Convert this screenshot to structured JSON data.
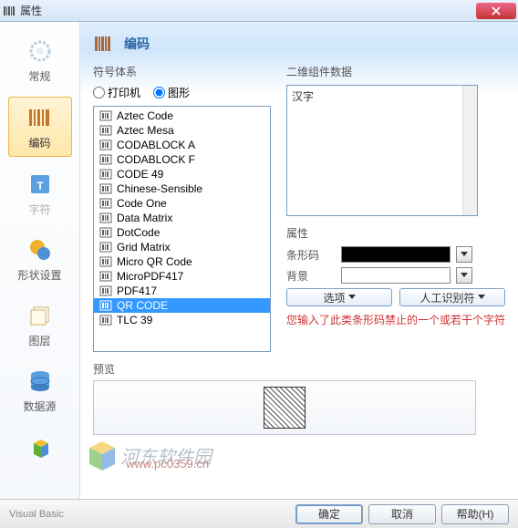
{
  "window": {
    "title": "属性"
  },
  "sidebar": {
    "items": [
      {
        "label": "常规",
        "icon": "gear-icon"
      },
      {
        "label": "编码",
        "icon": "barcode-icon"
      },
      {
        "label": "字符",
        "icon": "text-icon"
      },
      {
        "label": "形状设置",
        "icon": "shape-icon"
      },
      {
        "label": "图层",
        "icon": "layers-icon"
      },
      {
        "label": "数据源",
        "icon": "database-icon"
      }
    ],
    "active_index": 1
  },
  "header": {
    "title": "编码"
  },
  "symbol_group": {
    "title": "符号体系",
    "radio_printer": "打印机",
    "radio_graphic": "图形",
    "selected": "graphic",
    "list": [
      "Aztec Code",
      "Aztec Mesa",
      "CODABLOCK A",
      "CODABLOCK F",
      "CODE 49",
      "Chinese-Sensible",
      "Code One",
      "Data Matrix",
      "DotCode",
      "Grid Matrix",
      "Micro QR Code",
      "MicroPDF417",
      "PDF417",
      "QR CODE",
      "TLC 39"
    ],
    "selected_index": 13
  },
  "data_group": {
    "title": "二维组件数据",
    "value": "汉字"
  },
  "props": {
    "title": "属性",
    "barcode_label": "条形码",
    "barcode_color": "#000000",
    "background_label": "背景",
    "background_color": "#ffffff",
    "options_btn": "选项",
    "human_readable_btn": "人工识别符"
  },
  "error": "您输入了此类条形码禁止的一个或若干个字符",
  "preview": {
    "label": "预览"
  },
  "footer": {
    "status": "Visual Basic",
    "ok": "确定",
    "cancel": "取消",
    "help": "帮助(H)"
  },
  "watermark": {
    "text": "河东软件园",
    "url": "www.pc0359.cn"
  }
}
